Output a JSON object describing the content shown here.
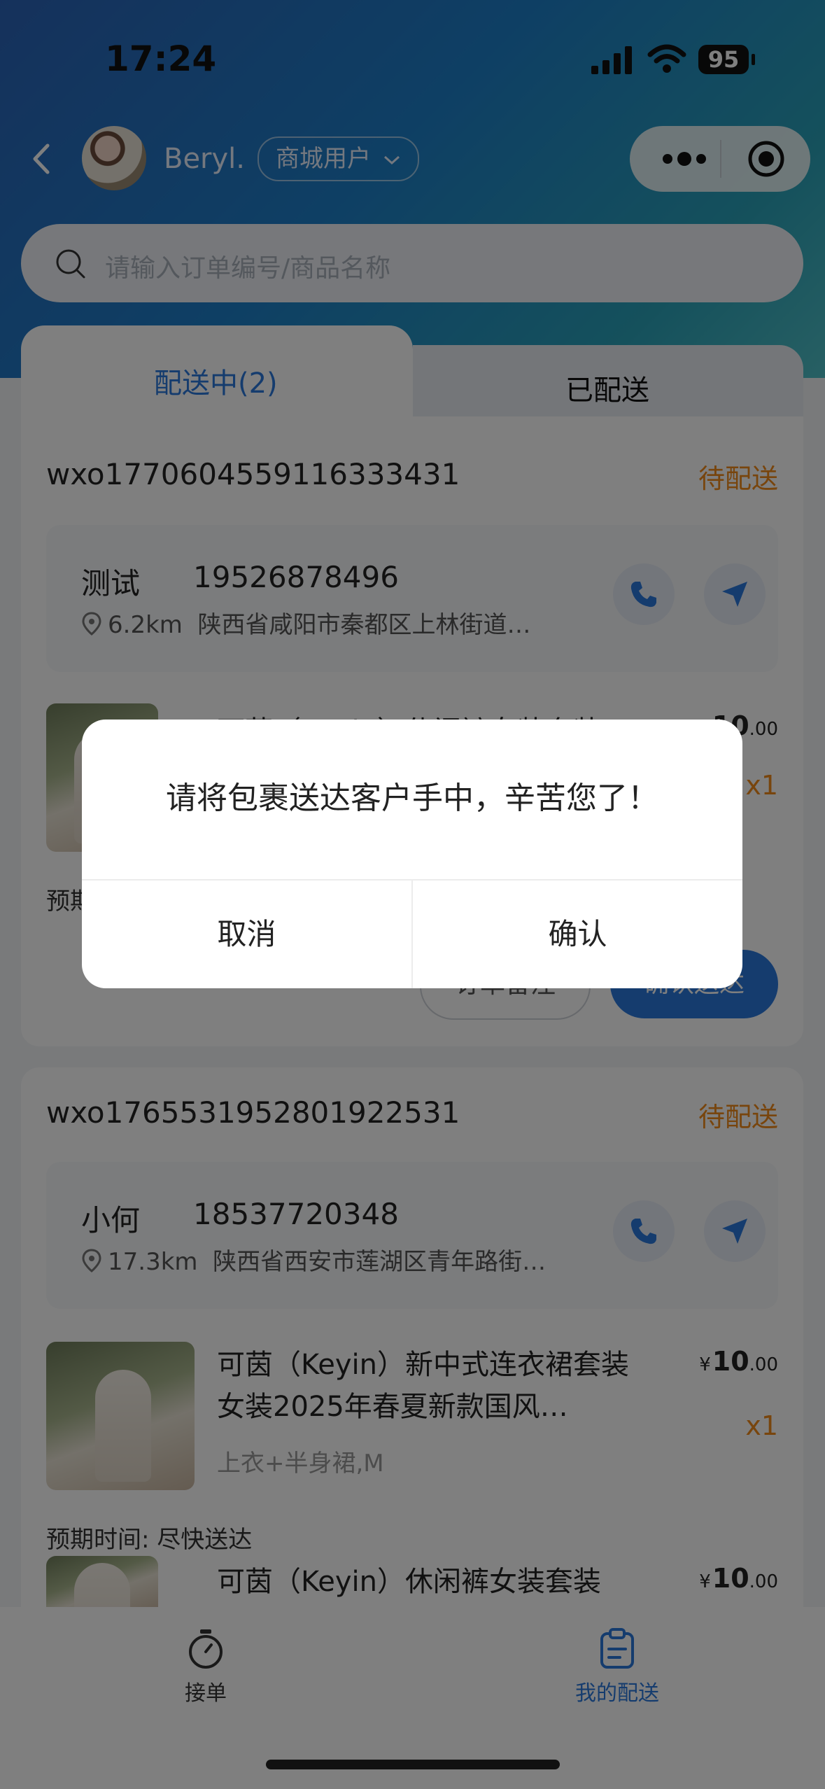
{
  "status_bar": {
    "time": "17:24",
    "battery": "95"
  },
  "navbar": {
    "username": "Beryl.",
    "role": "商城用户"
  },
  "search": {
    "placeholder": "请输入订单编号/商品名称"
  },
  "tabs": [
    {
      "label": "配送中(2)"
    },
    {
      "label": "已配送"
    }
  ],
  "orders": [
    {
      "order_no": "wxo1770604559116333431",
      "status": "待配送",
      "customer_name": "测试",
      "customer_phone": "19526878496",
      "distance": "6.2km",
      "address": "陕西省咸阳市秦都区上林街道…",
      "product_title": "可茵（Keyin）休闲裤女装套装",
      "price_int": "10",
      "price_dec": ".00",
      "qty": "x1",
      "expected_time": "预期时间: 尽快送达",
      "note_button": "订单备注",
      "confirm_button": "确认送达"
    },
    {
      "order_no": "wxo1765531952801922531",
      "status": "待配送",
      "customer_name": "小何",
      "customer_phone": "18537720348",
      "distance": "17.3km",
      "address": "陕西省西安市莲湖区青年路街…",
      "products": [
        {
          "title": "可茵（Keyin）新中式连衣裙套装女装2025年春夏新款国风…",
          "spec": "上衣+半身裙,M",
          "currency": "¥",
          "price_int": "10",
          "price_dec": ".00",
          "qty": "x1"
        },
        {
          "title": "可茵（Keyin）休闲裤女装套装",
          "currency": "¥",
          "price_int": "10",
          "price_dec": ".00"
        }
      ],
      "expected_time": "预期时间: 尽快送达"
    }
  ],
  "tabbar": [
    {
      "label": "接单"
    },
    {
      "label": "我的配送"
    }
  ],
  "dialog": {
    "message": "请将包裹送达客户手中，辛苦您了！",
    "cancel": "取消",
    "confirm": "确认"
  },
  "colors": {
    "accent": "#2a78dc",
    "warning": "#f08a1b"
  }
}
